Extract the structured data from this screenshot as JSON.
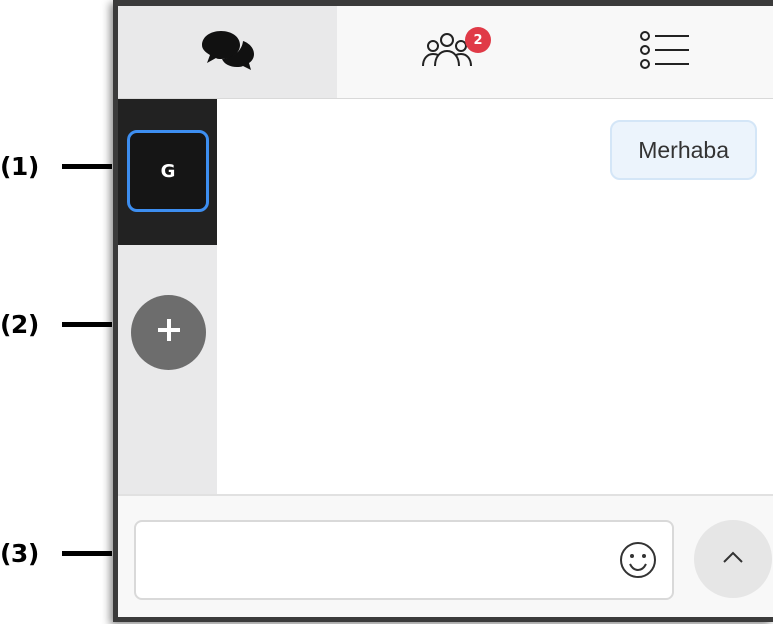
{
  "callouts": {
    "c1": "(1)",
    "c2": "(2)",
    "c3": "(3)"
  },
  "tabs": [
    {
      "name": "chat",
      "icon": "chat-bubbles-icon",
      "active": true
    },
    {
      "name": "people",
      "icon": "people-icon",
      "badge": "2"
    },
    {
      "name": "list",
      "icon": "list-icon"
    }
  ],
  "sidebar": {
    "server_initial": "G",
    "add_icon": "plus-icon"
  },
  "messages": [
    {
      "text": "Merhaba"
    }
  ],
  "composer": {
    "input_value": "",
    "placeholder": "",
    "emoji_icon": "smiley-icon",
    "send_icon": "chevron-up-icon"
  },
  "colors": {
    "badge": "#e03a47",
    "selected_border": "#3d8ef0",
    "server_strip": "#222222",
    "bubble_bg": "#ecf4fc"
  }
}
